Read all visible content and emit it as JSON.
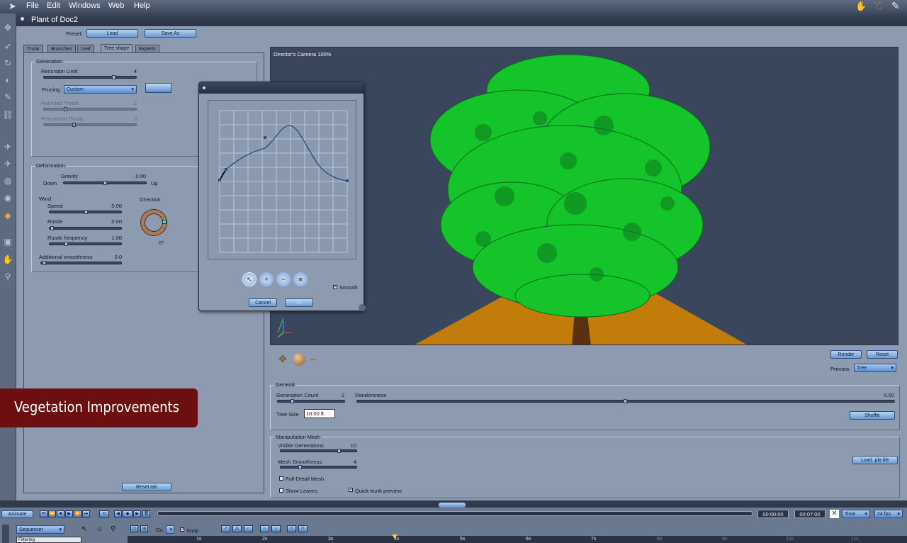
{
  "menu": [
    "File",
    "Edit",
    "Windows",
    "Web",
    "Help"
  ],
  "window_title": "Plant of Doc2",
  "preset": {
    "label": "Preset:",
    "load": "Load",
    "save_as": "Save As"
  },
  "tabs": [
    "Trunk",
    "Branches",
    "Leaf",
    "Tree shape",
    "Experts"
  ],
  "active_tab": "Tree shape",
  "generation": {
    "title": "Generation",
    "recursion_limit": {
      "label": "Recursion Limit",
      "value": "4"
    },
    "pruning": {
      "label": "Pruning",
      "value": "Custom"
    },
    "ramified": {
      "label": "Ramified Thrsld.",
      "value": "2"
    },
    "procedural": {
      "label": "Procedural Thrsld.",
      "value": "3"
    }
  },
  "deformation": {
    "title": "Deformation",
    "gravity": {
      "label": "Gravity",
      "value": "0.00",
      "down": "Down",
      "up": "Up"
    },
    "wind": "Wind",
    "direction": {
      "label": "Direction",
      "value": "0º"
    },
    "speed": {
      "label": "Speed",
      "value": "0.00"
    },
    "rustle": {
      "label": "Rustle",
      "value": "0.00"
    },
    "rustle_frequency": {
      "label": "Rustle frequency",
      "value": "1.00"
    },
    "additional_smoothness": {
      "label": "Additional smoothness",
      "value": "0.0"
    }
  },
  "reset_tab": "Reset tab",
  "dialog": {
    "smooth": "Smooth",
    "cancel": "Cancel",
    "ok": "OK"
  },
  "viewport": {
    "camera": "Director's Camera 100%"
  },
  "render": "Render",
  "reset": "Reset",
  "preview": {
    "label": "Preview",
    "value": "Tree"
  },
  "general": {
    "title": "General",
    "generation_count": {
      "label": "Generation Count",
      "value": "2"
    },
    "randomness": {
      "label": "Randomness",
      "value": "0.50"
    },
    "tree_size": {
      "label": "Tree Size",
      "value": "10.00 ft"
    },
    "shuffle": "Shuffle"
  },
  "manipulation_mesh": {
    "title": "Manipulation Mesh",
    "visible_generations": {
      "label": "Visible Generations",
      "value": "10"
    },
    "mesh_smoothness": {
      "label": "Mesh Smoothness",
      "value": "4"
    },
    "full_detail_mesh": "Full-Detail Mesh",
    "show_leaves": "Show Leaves",
    "quick_trunk_preview": "Quick trunk preview",
    "load_pla": "Load .pla file"
  },
  "banner": "Vegetation Improvements",
  "timeline": {
    "animate": "Animate",
    "time_start": "00:00:00",
    "time_end": "00:07:00",
    "time_mode": "Time",
    "fps": "24 fps",
    "sequencer": "Sequencer",
    "filtering": "Filtering",
    "do": "Do:",
    "snap": "Snap",
    "ticks": [
      "1s",
      "2s",
      "3s",
      "4s",
      "5s",
      "6s",
      "7s",
      "8s",
      "9s",
      "10s",
      "11s"
    ]
  },
  "colors": {
    "foliage": "#15c32a",
    "ground": "#c27c0a",
    "viewport_bg": "#39465c",
    "banner": "#6b0f10"
  }
}
